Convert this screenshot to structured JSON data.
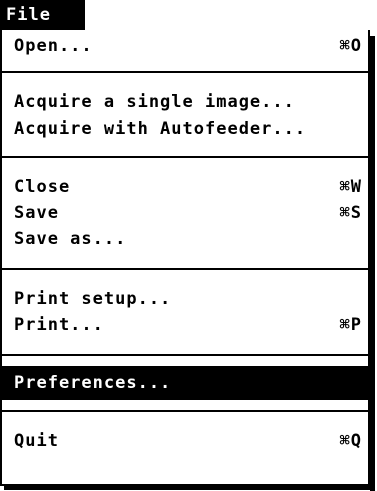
{
  "menu": {
    "title": "File",
    "items": [
      {
        "label": "Open...",
        "shortcut": "⌘O"
      },
      {
        "label": "Acquire a single image..."
      },
      {
        "label": "Acquire with Autofeeder..."
      },
      {
        "label": "Close",
        "shortcut": "⌘W"
      },
      {
        "label": "Save",
        "shortcut": "⌘S"
      },
      {
        "label": "Save as..."
      },
      {
        "label": "Print  setup..."
      },
      {
        "label": "Print...",
        "shortcut": "⌘P"
      },
      {
        "label": "Preferences...",
        "highlighted": true
      },
      {
        "label": "Quit",
        "shortcut": "⌘Q"
      }
    ]
  },
  "colors": {
    "background": "#ffffff",
    "foreground": "#000000",
    "highlight": "#000000",
    "highlight_text": "#ffffff"
  }
}
